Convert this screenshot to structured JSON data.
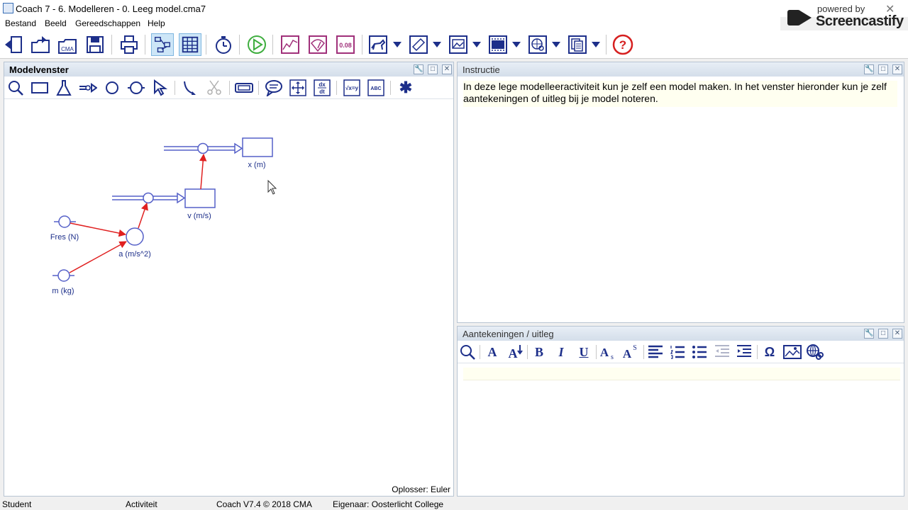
{
  "window": {
    "title": "Coach 7 - 6. Modelleren - 0. Leeg model.cma7",
    "close_glyph": "✕"
  },
  "watermark": {
    "line1": "powered by",
    "line2": "Screencastify"
  },
  "menu": [
    "Bestand",
    "Beeld",
    "Gereedschappen",
    "Help"
  ],
  "toolbar": {
    "icons": [
      "open-icon",
      "export-icon",
      "cma-icon",
      "save-icon",
      "print-icon",
      "model-view-icon",
      "table-icon",
      "stopwatch-icon",
      "run-icon",
      "graph-icon",
      "meter-icon",
      "value-display-icon",
      "animation-icon",
      "notes-icon",
      "image-icon",
      "video-icon",
      "web-icon",
      "text-icon",
      "help-icon"
    ],
    "cma_label": "CMA",
    "value_label": "0.08",
    "help_label": "?"
  },
  "model_window": {
    "title": "Modelvenster",
    "tools": [
      "zoom-icon",
      "stock-icon",
      "flask-icon",
      "flow-icon",
      "auxiliary-icon",
      "constant-icon",
      "pointer-icon",
      "connector-icon",
      "scissors-icon",
      "condition-icon",
      "comment-icon",
      "fit-icon",
      "derivative-icon",
      "formula-icon",
      "text-icon",
      "asterisk-icon"
    ],
    "derivative_label": "dx\ndt",
    "formula_label": "√x=y",
    "text_label": "ABC",
    "asterisk_label": "✱",
    "solver": "Oplosser: Euler",
    "nodes": {
      "x": "x (m)",
      "v": "v (m/s)",
      "a": "a (m/s^2)",
      "fres": "Fres (N)",
      "m": "m (kg)"
    }
  },
  "instructie": {
    "title": "Instructie",
    "text": "In deze lege modelleeractiviteit kun je zelf een model maken. In het venster hieronder kun je zelf aantekeningen of uitleg bij je model noteren."
  },
  "notes": {
    "title": "Aantekeningen / uitleg",
    "tools": [
      "find-icon",
      "font-icon",
      "font-color-icon",
      "bold-icon",
      "italic-icon",
      "underline-icon",
      "subscript-icon",
      "superscript-icon",
      "align-icon",
      "numbered-list-icon",
      "bullet-list-icon",
      "outdent-icon",
      "indent-icon",
      "symbol-icon",
      "image-icon",
      "link-icon"
    ],
    "labels": {
      "font": "A",
      "bold": "B",
      "italic": "I",
      "underline": "U",
      "subscript": "As",
      "superscript": "AS",
      "symbol": "Ω"
    }
  },
  "panel_buttons": {
    "pin": "🔧",
    "float": "□",
    "close": "✕"
  },
  "status": {
    "user": "Student",
    "activity": "Activiteit",
    "version": "Coach V7.4 © 2018 CMA",
    "owner": "Eigenaar: Oosterlicht College"
  },
  "colors": {
    "icon_blue": "#1d2f8a",
    "link_red": "#e02020",
    "run_green": "#3fae3f",
    "graph_purple": "#a0307a",
    "help_red": "#d62020"
  }
}
